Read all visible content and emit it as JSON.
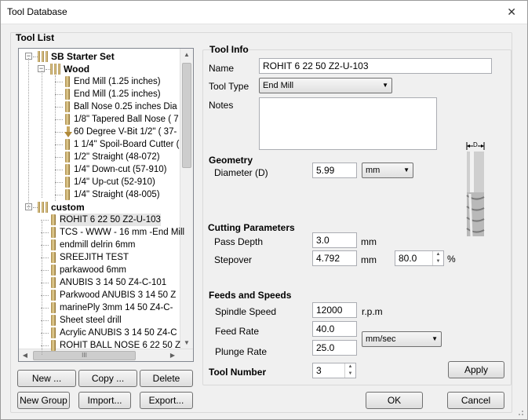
{
  "window": {
    "title": "Tool Database",
    "close_glyph": "✕"
  },
  "tool_list": {
    "heading": "Tool List",
    "items": [
      {
        "label": "SB Starter Set",
        "kind": "group",
        "level": 0
      },
      {
        "label": "Wood",
        "kind": "group",
        "level": 1
      },
      {
        "label": "End Mill (1.25 inches)",
        "kind": "tool",
        "level": 2
      },
      {
        "label": "End Mill (1.25 inches)",
        "kind": "tool",
        "level": 2
      },
      {
        "label": "Ball Nose 0.25 inches Dia",
        "kind": "tool",
        "level": 2
      },
      {
        "label": "1/8\" Tapered Ball Nose ( 7",
        "kind": "tool",
        "level": 2
      },
      {
        "label": "60 Degree V-Bit 1/2\"  ( 37-",
        "kind": "vbit",
        "level": 2
      },
      {
        "label": "1 1/4\" Spoil-Board Cutter (",
        "kind": "tool",
        "level": 2
      },
      {
        "label": "1/2\" Straight  (48-072)",
        "kind": "tool",
        "level": 2
      },
      {
        "label": "1/4\"  Down-cut (57-910)",
        "kind": "tool",
        "level": 2
      },
      {
        "label": "1/4\" Up-cut (52-910)",
        "kind": "tool",
        "level": 2
      },
      {
        "label": "1/4\" Straight  (48-005)",
        "kind": "tool",
        "level": 2
      },
      {
        "label": "custom",
        "kind": "group",
        "level": 0
      },
      {
        "label": "ROHIT 6 22 50   Z2-U-103",
        "kind": "tool",
        "level": 1,
        "selected": true
      },
      {
        "label": "TCS - WWW - 16 mm -End Mill",
        "kind": "tool",
        "level": 1
      },
      {
        "label": "endmill delrin 6mm",
        "kind": "tool",
        "level": 1
      },
      {
        "label": "SREEJITH TEST",
        "kind": "tool",
        "level": 1
      },
      {
        "label": "parkawood 6mm",
        "kind": "tool",
        "level": 1
      },
      {
        "label": "ANUBIS 3  14 50    Z4-C-101",
        "kind": "tool",
        "level": 1
      },
      {
        "label": "Parkwood ANUBIS 3  14 50   Z",
        "kind": "tool",
        "level": 1
      },
      {
        "label": "marinePly 3mm  14 50    Z4-C-",
        "kind": "tool",
        "level": 1
      },
      {
        "label": "Sheet steel drill",
        "kind": "tool",
        "level": 1
      },
      {
        "label": "Acrylic ANUBIS 3  14 50    Z4-C",
        "kind": "tool",
        "level": 1
      },
      {
        "label": "ROHIT BALL NOSE 6 22 50   Z",
        "kind": "tool",
        "level": 1
      }
    ],
    "hscroll_grip": "III"
  },
  "list_buttons": {
    "new": "New ...",
    "copy": "Copy ...",
    "delete": "Delete",
    "new_group": "New Group",
    "import": "Import...",
    "export": "Export..."
  },
  "tool_info": {
    "heading": "Tool Info",
    "name_label": "Name",
    "name_value": "ROHIT 6 22 50   Z2-U-103",
    "type_label": "Tool Type",
    "type_value": "End Mill",
    "notes_label": "Notes",
    "notes_value": ""
  },
  "geometry": {
    "heading": "Geometry",
    "diameter_label": "Diameter (D)",
    "diameter_value": "5.99",
    "unit": "mm",
    "diagram_label": "D"
  },
  "cutting": {
    "heading": "Cutting Parameters",
    "pass_depth_label": "Pass Depth",
    "pass_depth_value": "3.0",
    "pass_depth_unit": "mm",
    "stepover_label": "Stepover",
    "stepover_value": "4.792",
    "stepover_unit": "mm",
    "stepover_percent": "80.0",
    "percent_sign": "%"
  },
  "feeds": {
    "heading": "Feeds and Speeds",
    "spindle_label": "Spindle Speed",
    "spindle_value": "12000",
    "spindle_unit": "r.p.m",
    "feed_label": "Feed Rate",
    "feed_value": "40.0",
    "plunge_label": "Plunge Rate",
    "plunge_value": "25.0",
    "rate_unit": "mm/sec"
  },
  "tool_number": {
    "label": "Tool Number",
    "value": "3"
  },
  "actions": {
    "apply": "Apply",
    "ok": "OK",
    "cancel": "Cancel"
  }
}
